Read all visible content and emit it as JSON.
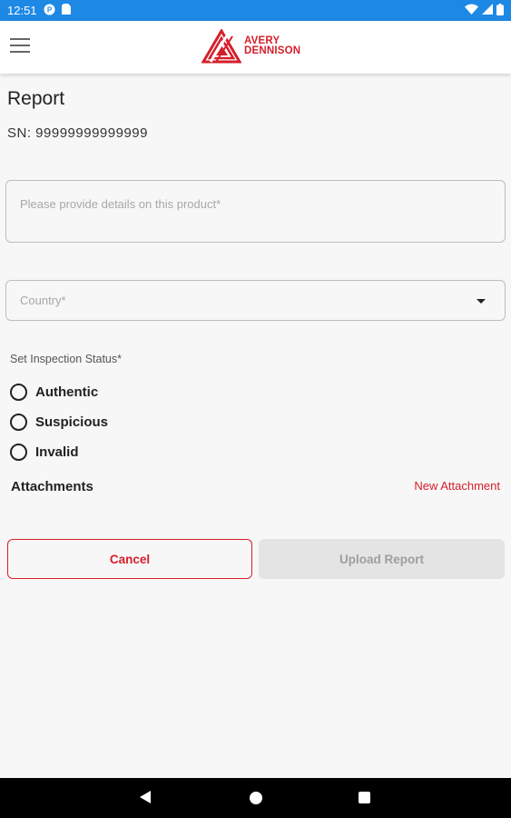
{
  "status_bar": {
    "time": "12:51",
    "icons": [
      "notification-app-icon",
      "sim-card-icon",
      "wifi-icon",
      "signal-icon",
      "battery-icon"
    ]
  },
  "app_bar": {
    "logo_line1": "AVERY",
    "logo_line2": "DENNISON",
    "brand_color": "#d51f2b"
  },
  "page": {
    "title": "Report",
    "serial": "SN: 99999999999999"
  },
  "form": {
    "details_placeholder": "Please provide details on this product*",
    "details_value": "",
    "country_placeholder": "Country*",
    "status_label": "Set Inspection Status*",
    "status_options": [
      {
        "label": "Authentic",
        "selected": false
      },
      {
        "label": "Suspicious",
        "selected": false
      },
      {
        "label": "Invalid",
        "selected": false
      }
    ],
    "attachments_label": "Attachments",
    "new_attachment_label": "New Attachment"
  },
  "actions": {
    "cancel_label": "Cancel",
    "upload_label": "Upload Report"
  },
  "colors": {
    "status_bar": "#1e88e5",
    "accent": "#d51f2b",
    "disabled_button": "#e4e4e4"
  }
}
